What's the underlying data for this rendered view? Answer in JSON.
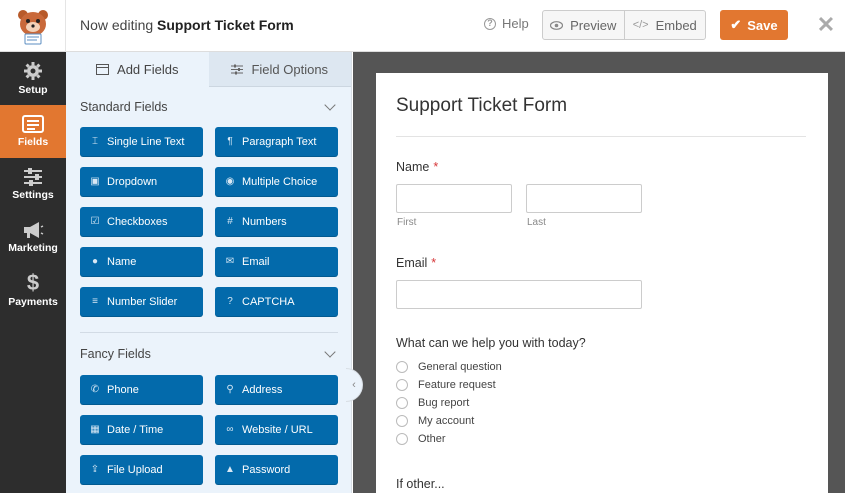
{
  "header": {
    "editing_prefix": "Now editing",
    "form_name": "Support Ticket Form",
    "help_label": "Help",
    "preview_label": "Preview",
    "embed_label": "Embed",
    "save_label": "Save"
  },
  "nav": {
    "items": [
      {
        "label": "Setup",
        "icon": "gear-icon"
      },
      {
        "label": "Fields",
        "icon": "fields-icon",
        "active": true
      },
      {
        "label": "Settings",
        "icon": "sliders-icon"
      },
      {
        "label": "Marketing",
        "icon": "megaphone-icon"
      },
      {
        "label": "Payments",
        "icon": "dollar-icon"
      }
    ]
  },
  "panel": {
    "tab_add": "Add Fields",
    "tab_options": "Field Options",
    "standard_title": "Standard Fields",
    "fancy_title": "Fancy Fields",
    "standard": [
      "Single Line Text",
      "Paragraph Text",
      "Dropdown",
      "Multiple Choice",
      "Checkboxes",
      "Numbers",
      "Name",
      "Email",
      "Number Slider",
      "CAPTCHA"
    ],
    "fancy": [
      "Phone",
      "Address",
      "Date / Time",
      "Website / URL",
      "File Upload",
      "Password"
    ]
  },
  "form": {
    "title": "Support Ticket Form",
    "name_label": "Name",
    "required_mark": "*",
    "first_sub": "First",
    "last_sub": "Last",
    "email_label": "Email",
    "question_label": "What can we help you with today?",
    "options": [
      "General question",
      "Feature request",
      "Bug report",
      "My account",
      "Other"
    ],
    "other_label": "If other..."
  },
  "colors": {
    "accent": "#e27730",
    "field_button": "#036aab",
    "nav_bg": "#2d2d2d",
    "panel_bg": "#ebf3fb"
  }
}
